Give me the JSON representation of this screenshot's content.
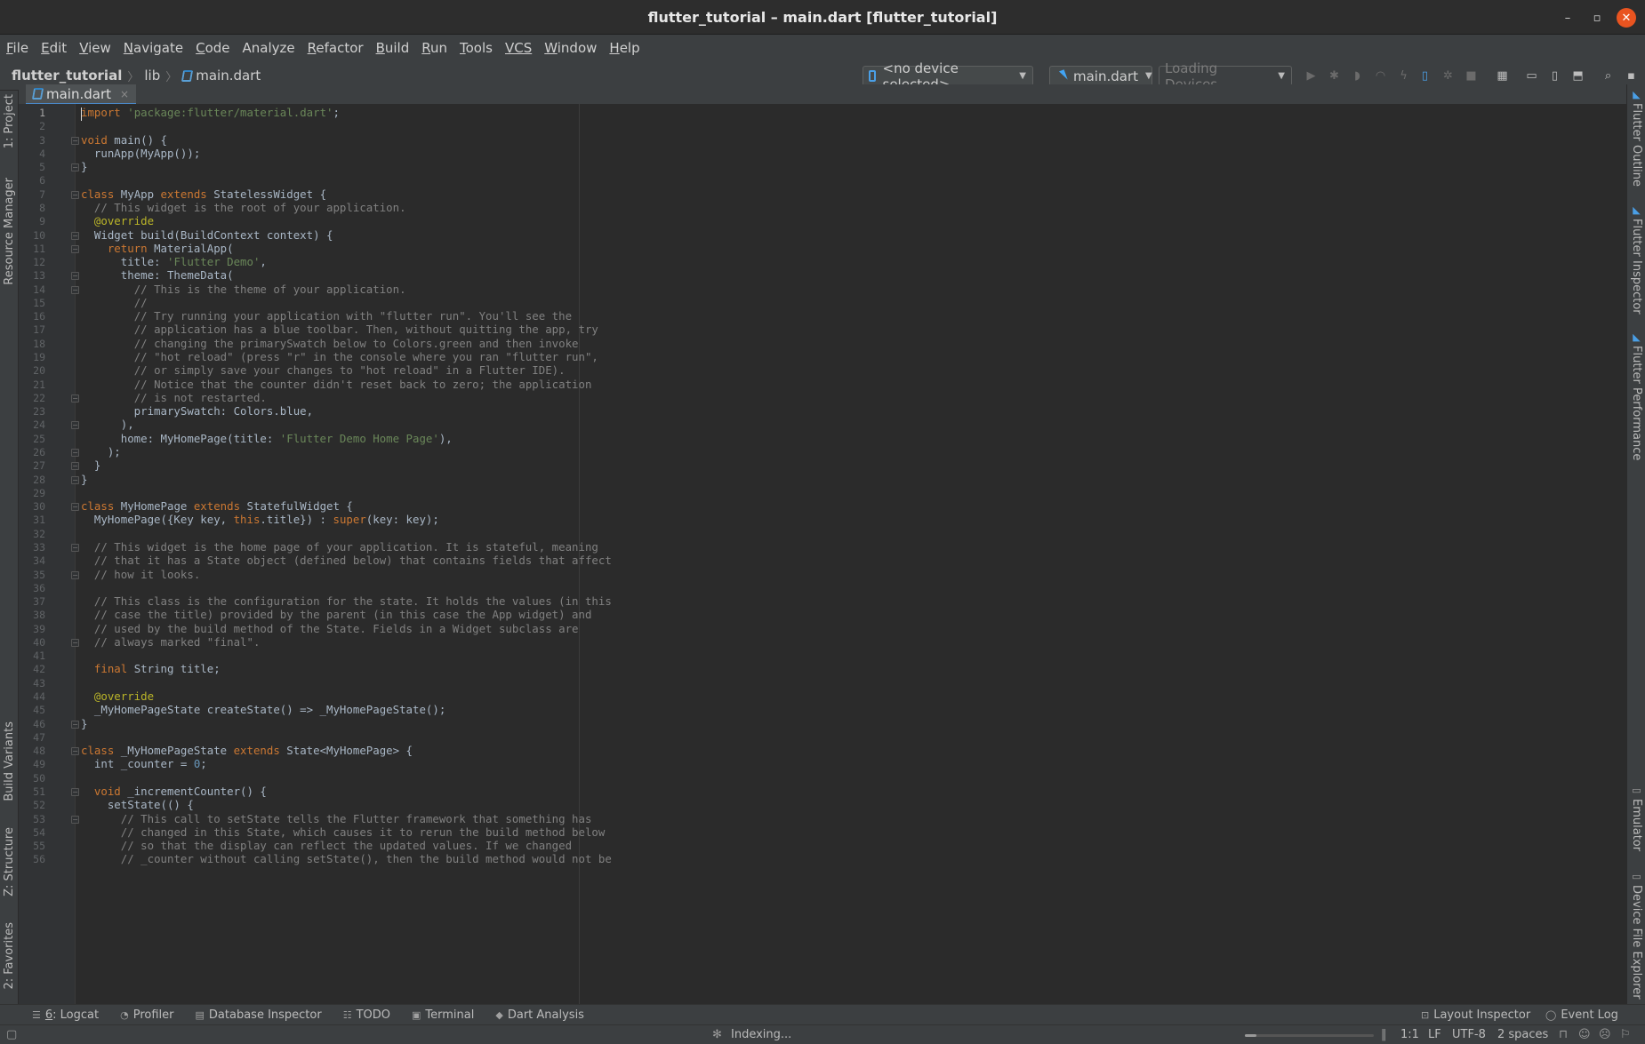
{
  "window": {
    "title": "flutter_tutorial – main.dart [flutter_tutorial]"
  },
  "menu": [
    {
      "m": "F",
      "rest": "ile"
    },
    {
      "m": "E",
      "rest": "dit"
    },
    {
      "m": "V",
      "rest": "iew"
    },
    {
      "m": "N",
      "rest": "avigate"
    },
    {
      "m": "C",
      "rest": "ode"
    },
    {
      "m": "",
      "rest": "Analyze"
    },
    {
      "m": "R",
      "rest": "efactor"
    },
    {
      "m": "B",
      "rest": "uild"
    },
    {
      "m": "R",
      "rest": "un"
    },
    {
      "m": "T",
      "rest": "ools"
    },
    {
      "m": "VCS",
      "rest": ""
    },
    {
      "m": "W",
      "rest": "indow"
    },
    {
      "m": "H",
      "rest": "elp"
    }
  ],
  "breadcrumb": {
    "project": "flutter_tutorial",
    "folder": "lib",
    "file": "main.dart"
  },
  "toolbar": {
    "device": "<no device selected>",
    "run_config": "main.dart",
    "loading": "Loading Devices..."
  },
  "tab": {
    "label": "main.dart"
  },
  "left_tools": {
    "project": "1: Project",
    "resource_manager": "Resource Manager",
    "build_variants": "Build Variants",
    "structure": "Z: Structure",
    "favorites": "2: Favorites"
  },
  "right_tools": {
    "flutter_outline": "Flutter Outline",
    "flutter_inspector": "Flutter Inspector",
    "flutter_performance": "Flutter Performance",
    "emulator": "Emulator",
    "device_file_explorer": "Device File Explorer"
  },
  "code_lines": [
    "<span class=\"kw\">import</span> <span class=\"str\">'package:flutter/material.dart'</span>;",
    "",
    "<span class=\"kw\">void</span> main() {",
    "  runApp(MyApp());",
    "}",
    "",
    "<span class=\"kw\">class</span> MyApp <span class=\"kw\">extends</span> StatelessWidget {",
    "  <span class=\"cm\">// This widget is the root of your application.</span>",
    "  <span class=\"ann\">@override</span>",
    "  Widget build(BuildContext context) {",
    "    <span class=\"kw\">return</span> MaterialApp(",
    "      title: <span class=\"str\">'Flutter Demo'</span>,",
    "      theme: ThemeData(",
    "        <span class=\"cm\">// This is the theme of your application.</span>",
    "        <span class=\"cm\">//</span>",
    "        <span class=\"cm\">// Try running your application with \"flutter run\". You'll see the</span>",
    "        <span class=\"cm\">// application has a blue toolbar. Then, without quitting the app, try</span>",
    "        <span class=\"cm\">// changing the primarySwatch below to Colors.green and then invoke</span>",
    "        <span class=\"cm\">// \"hot reload\" (press \"r\" in the console where you ran \"flutter run\",</span>",
    "        <span class=\"cm\">// or simply save your changes to \"hot reload\" in a Flutter IDE).</span>",
    "        <span class=\"cm\">// Notice that the counter didn't reset back to zero; the application</span>",
    "        <span class=\"cm\">// is not restarted.</span>",
    "        primarySwatch: Colors.blue,",
    "      ),",
    "      home: MyHomePage(title: <span class=\"str\">'Flutter Demo Home Page'</span>),",
    "    );",
    "  }",
    "}",
    "",
    "<span class=\"kw\">class</span> MyHomePage <span class=\"kw\">extends</span> StatefulWidget {",
    "  MyHomePage({Key key, <span class=\"kw\">this</span>.title}) : <span class=\"kw\">super</span>(key: key);",
    "",
    "  <span class=\"cm\">// This widget is the home page of your application. It is stateful, meaning</span>",
    "  <span class=\"cm\">// that it has a State object (defined below) that contains fields that affect</span>",
    "  <span class=\"cm\">// how it looks.</span>",
    "",
    "  <span class=\"cm\">// This class is the configuration for the state. It holds the values (in this</span>",
    "  <span class=\"cm\">// case the title) provided by the parent (in this case the App widget) and</span>",
    "  <span class=\"cm\">// used by the build method of the State. Fields in a Widget subclass are</span>",
    "  <span class=\"cm\">// always marked \"final\".</span>",
    "",
    "  <span class=\"kw\">final</span> String title;",
    "",
    "  <span class=\"ann\">@override</span>",
    "  _MyHomePageState createState() => _MyHomePageState();",
    "}",
    "",
    "<span class=\"kw\">class</span> _MyHomePageState <span class=\"kw\">extends</span> State&lt;MyHomePage&gt; {",
    "  int _counter = <span class=\"num\">0</span>;",
    "",
    "  <span class=\"kw\">void</span> _incrementCounter() {",
    "    setState(() {",
    "      <span class=\"cm\">// This call to setState tells the Flutter framework that something has</span>",
    "      <span class=\"cm\">// changed in this State, which causes it to rerun the build method below</span>",
    "      <span class=\"cm\">// so that the display can reflect the updated values. If we changed</span>",
    "      <span class=\"cm\">// _counter without calling setState(), then the build method would not be</span>"
  ],
  "fold_lines": [
    3,
    5,
    7,
    10,
    11,
    13,
    14,
    22,
    24,
    26,
    27,
    28,
    30,
    33,
    35,
    40,
    46,
    48,
    51,
    53
  ],
  "bottom_tools": [
    {
      "icon": "☰",
      "m": "6",
      "rest": ": Logcat"
    },
    {
      "icon": "◔",
      "m": "",
      "rest": "Profiler"
    },
    {
      "icon": "▤",
      "m": "",
      "rest": "Database Inspector"
    },
    {
      "icon": "☷",
      "m": "",
      "rest": "TODO"
    },
    {
      "icon": "▣",
      "m": "",
      "rest": "Terminal"
    },
    {
      "icon": "◆",
      "m": "",
      "rest": "Dart Analysis"
    }
  ],
  "bottom_right": {
    "layout_inspector": "Layout Inspector",
    "event_log": "Event Log"
  },
  "status": {
    "indexing": "Indexing...",
    "position": "1:1",
    "line_sep": "LF",
    "encoding": "UTF-8",
    "indent": "2 spaces",
    "progress_fraction": 0.09
  }
}
